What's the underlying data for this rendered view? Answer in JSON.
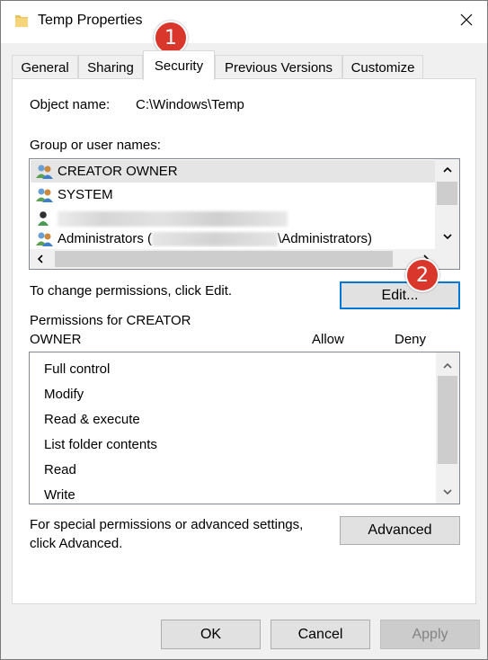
{
  "window": {
    "title": "Temp Properties"
  },
  "tabs": [
    {
      "label": "General"
    },
    {
      "label": "Sharing"
    },
    {
      "label": "Security"
    },
    {
      "label": "Previous Versions"
    },
    {
      "label": "Customize"
    }
  ],
  "security": {
    "object_name_label": "Object name:",
    "object_name_value": "C:\\Windows\\Temp",
    "group_label": "Group or user names:",
    "users": [
      {
        "name": "CREATOR OWNER",
        "selected": true
      },
      {
        "name": "SYSTEM"
      },
      {
        "name": ""
      },
      {
        "name_prefix": "Administrators (",
        "name_suffix": "\\Administrators)"
      }
    ],
    "change_hint": "To change permissions, click Edit.",
    "edit_label": "Edit...",
    "permissions_for_line1": "Permissions for CREATOR",
    "permissions_for_line2": "OWNER",
    "allow_header": "Allow",
    "deny_header": "Deny",
    "permissions": [
      "Full control",
      "Modify",
      "Read & execute",
      "List folder contents",
      "Read",
      "Write"
    ],
    "advanced_hint_line1": "For special permissions or advanced settings,",
    "advanced_hint_line2": "click Advanced.",
    "advanced_label": "Advanced"
  },
  "footer": {
    "ok_label": "OK",
    "cancel_label": "Cancel",
    "apply_label": "Apply"
  },
  "annotations": {
    "badge1": "1",
    "badge2": "2"
  },
  "colors": {
    "badge": "#d9372c",
    "focus": "#0078d7",
    "selection": "#e5e5e5"
  }
}
